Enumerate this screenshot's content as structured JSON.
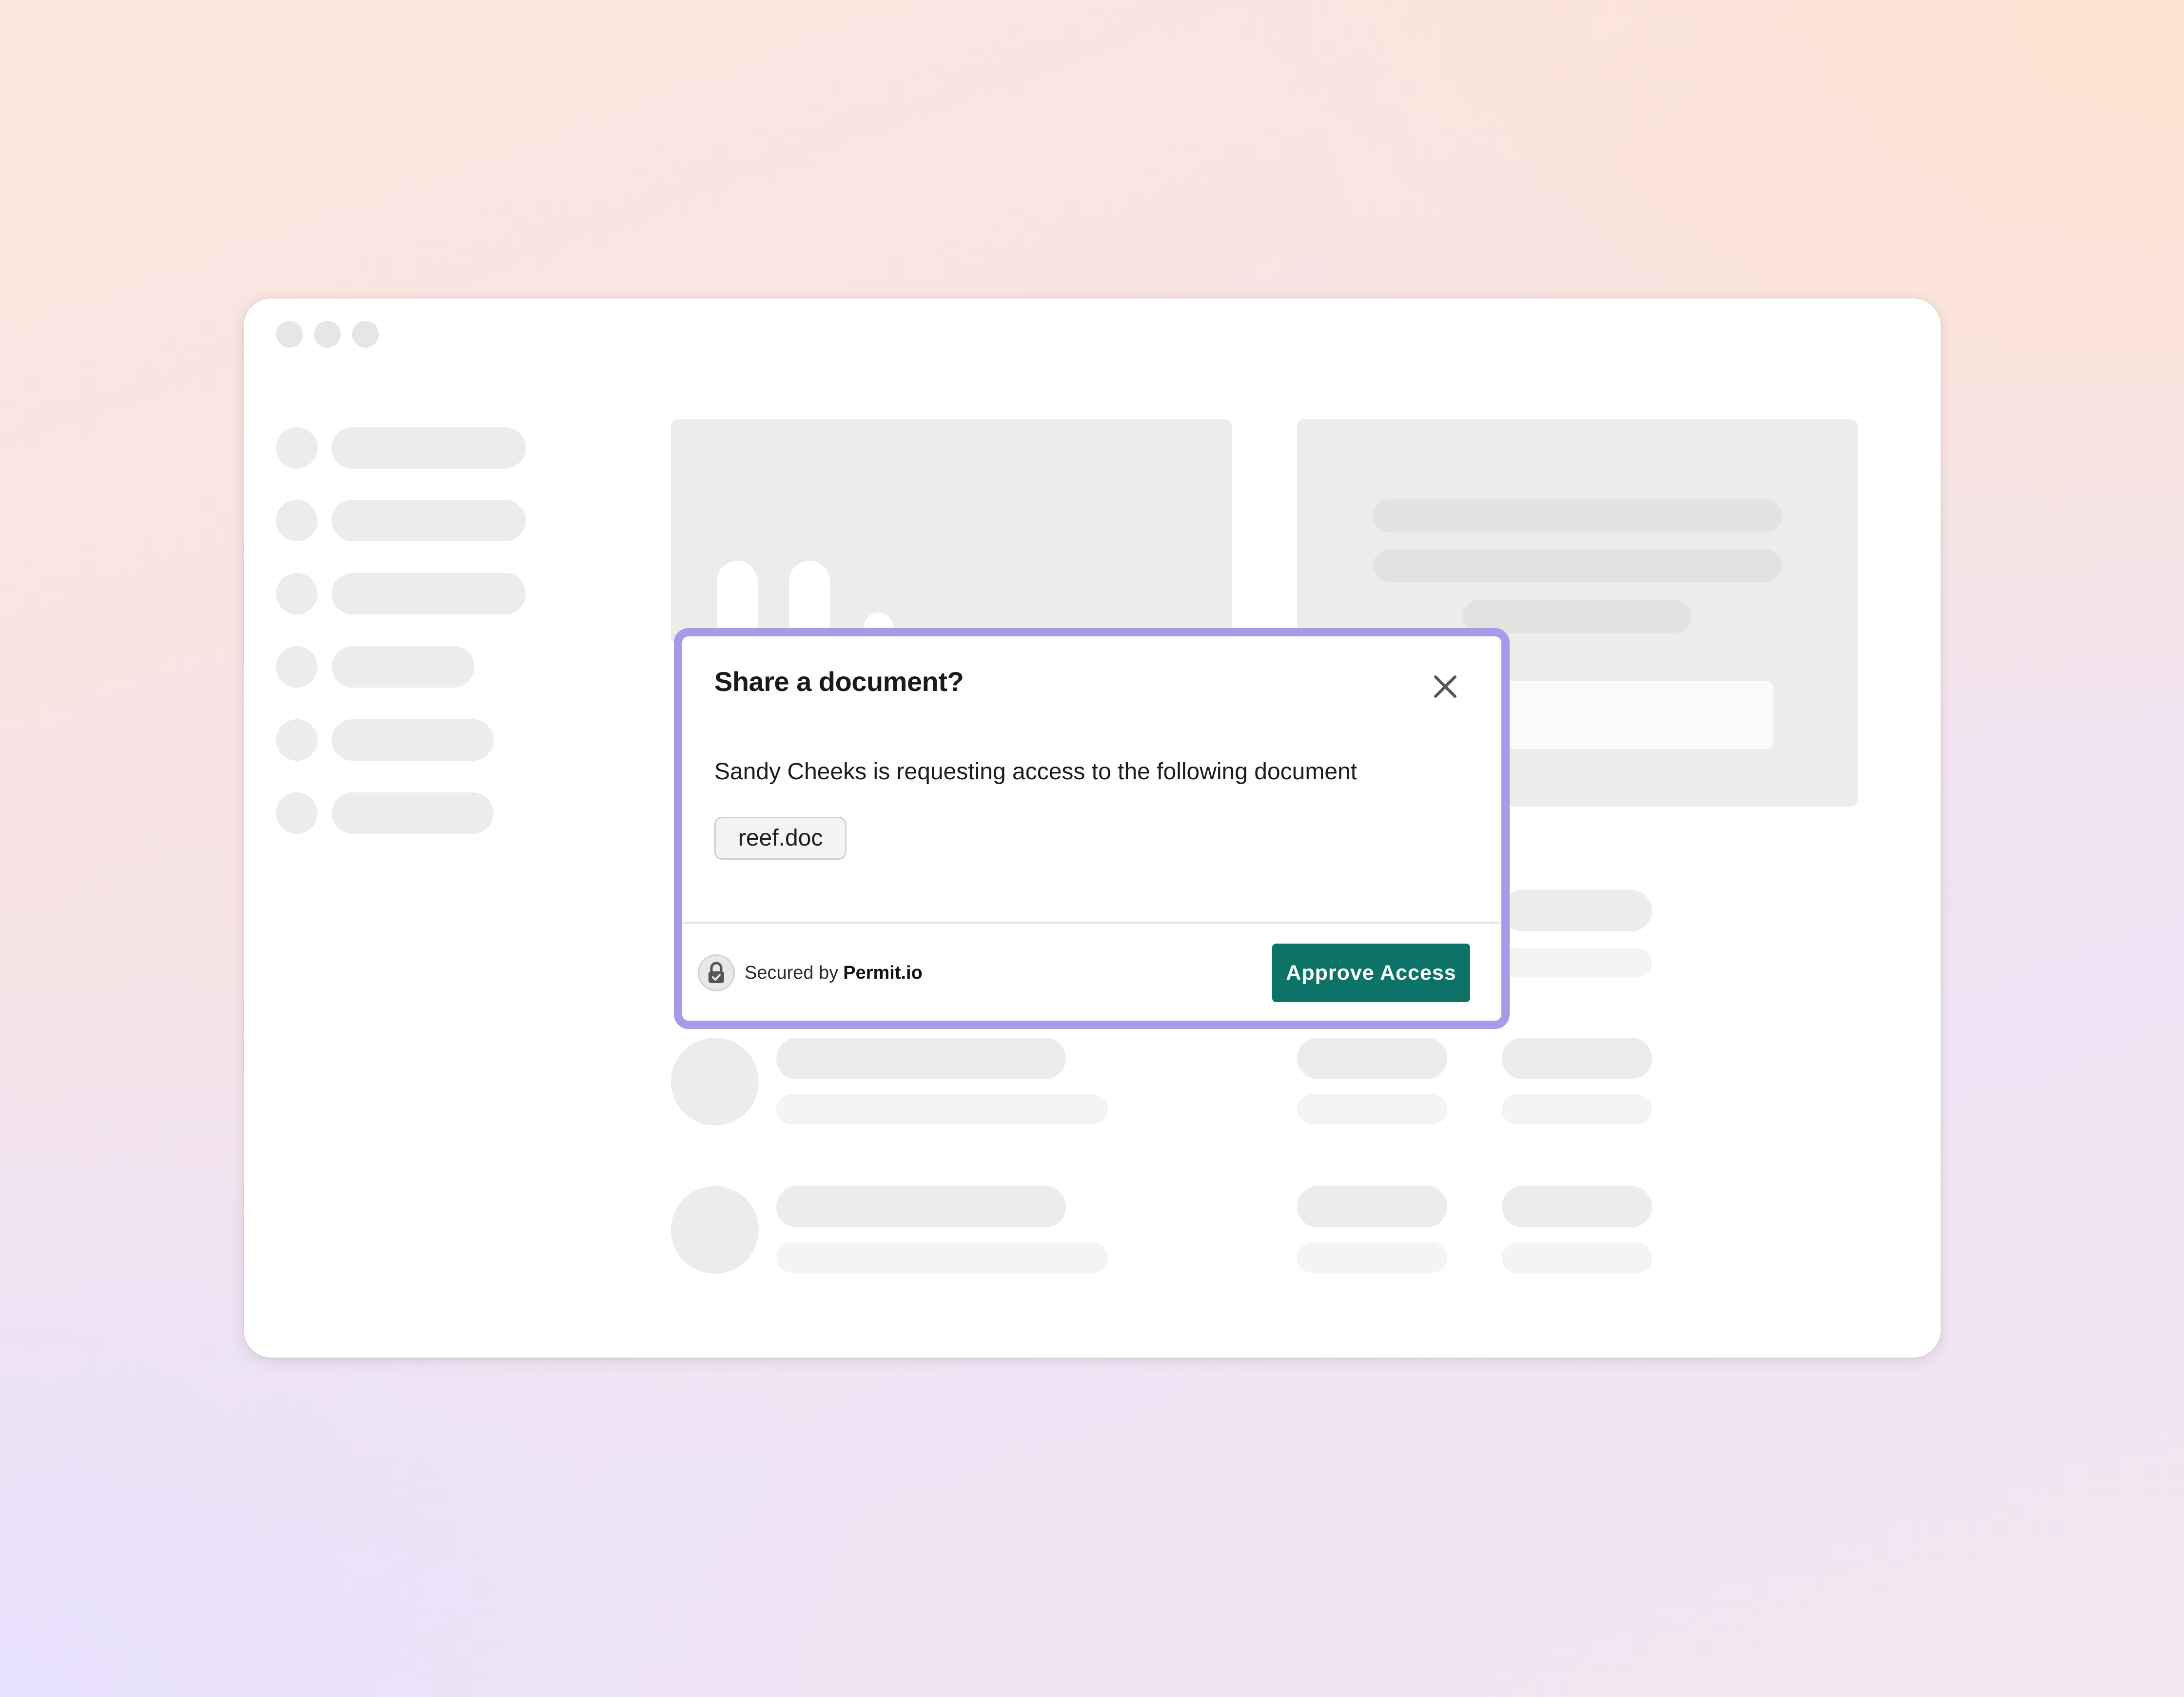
{
  "dialog": {
    "title": "Share a document?",
    "message": "Sandy Cheeks is requesting access to the following document",
    "document_name": "reef.doc",
    "close_icon": "close-icon",
    "footer": {
      "secured_prefix": "Secured by",
      "secured_brand": "Permit.io",
      "lock_icon": "lock-icon",
      "approve_label": "Approve Access"
    }
  },
  "colors": {
    "dialog_border": "#a79ae8",
    "approve_button": "#0d7366",
    "placeholder": "#ececeb"
  }
}
